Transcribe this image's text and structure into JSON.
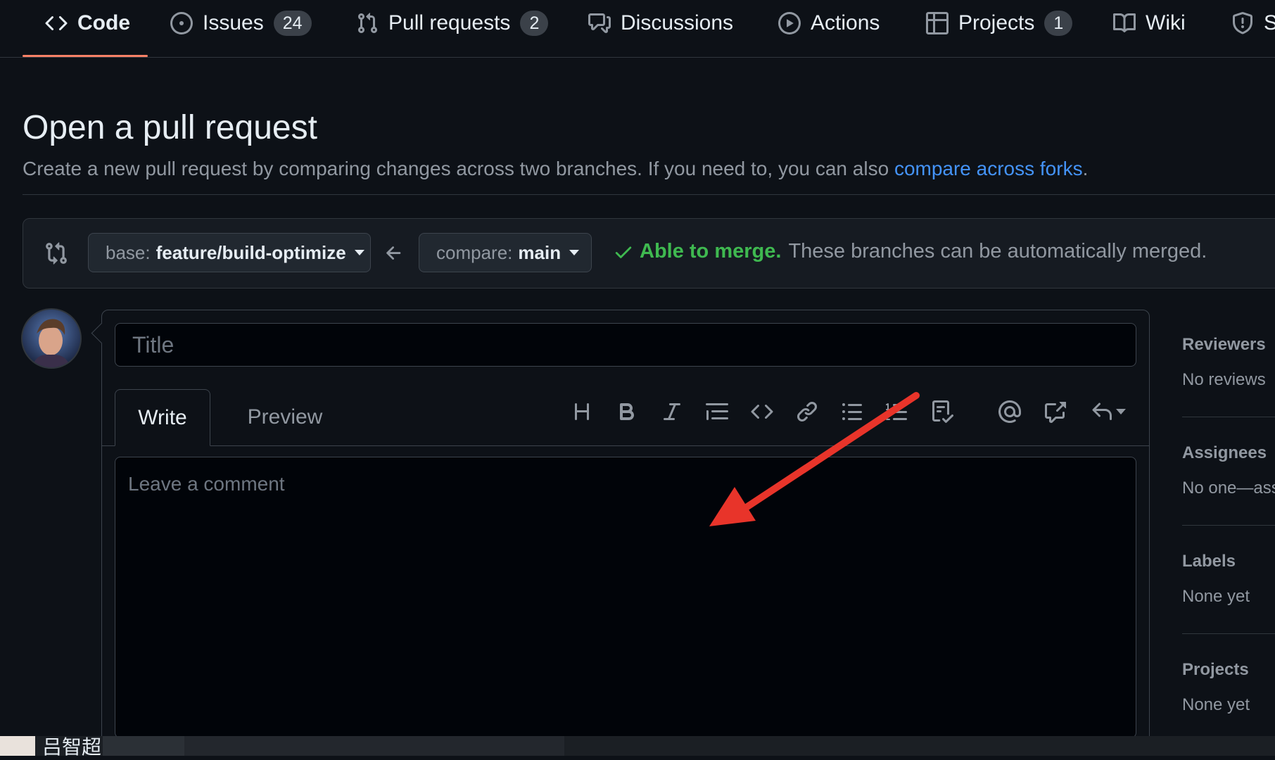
{
  "nav": {
    "tabs": [
      {
        "label": "Code",
        "icon": "code-icon"
      },
      {
        "label": "Issues",
        "count": "24",
        "icon": "issue-icon"
      },
      {
        "label": "Pull requests",
        "count": "2",
        "icon": "pull-request-icon"
      },
      {
        "label": "Discussions",
        "icon": "discussions-icon"
      },
      {
        "label": "Actions",
        "icon": "play-icon"
      },
      {
        "label": "Projects",
        "count": "1",
        "icon": "table-icon"
      },
      {
        "label": "Wiki",
        "icon": "book-icon"
      },
      {
        "label": "S",
        "icon": "shield-icon"
      }
    ]
  },
  "header": {
    "title": "Open a pull request",
    "description": "Create a new pull request by comparing changes across two branches. If you need to, you can also ",
    "link": "compare across forks",
    "end": "."
  },
  "compare": {
    "base_prefix": "base:",
    "base_branch": "feature/build-optimize",
    "compare_prefix": "compare:",
    "compare_branch": "main",
    "status_ok": "Able to merge.",
    "status_msg": "These branches can be automatically merged."
  },
  "form": {
    "title_placeholder": "Title",
    "write_tab": "Write",
    "preview_tab": "Preview",
    "comment_placeholder": "Leave a comment",
    "toolbar": [
      "heading-icon",
      "bold-icon",
      "italic-icon",
      "quote-icon",
      "code-icon",
      "link-icon",
      "unordered-list-icon",
      "ordered-list-icon",
      "task-list-icon",
      "mention-icon",
      "cross-reference-icon",
      "reply-icon"
    ]
  },
  "sidebar": {
    "reviewers": {
      "heading": "Reviewers",
      "value": "No reviews"
    },
    "assignees": {
      "heading": "Assignees",
      "value": "No one—ass"
    },
    "labels": {
      "heading": "Labels",
      "value": "None yet"
    },
    "projects": {
      "heading": "Projects",
      "value": "None yet"
    }
  },
  "bottom": {
    "text": "吕智超"
  },
  "colors": {
    "accent_underline": "#f78166",
    "link": "#4493f8",
    "success": "#3fb950",
    "annotation_arrow": "#e8342a"
  }
}
